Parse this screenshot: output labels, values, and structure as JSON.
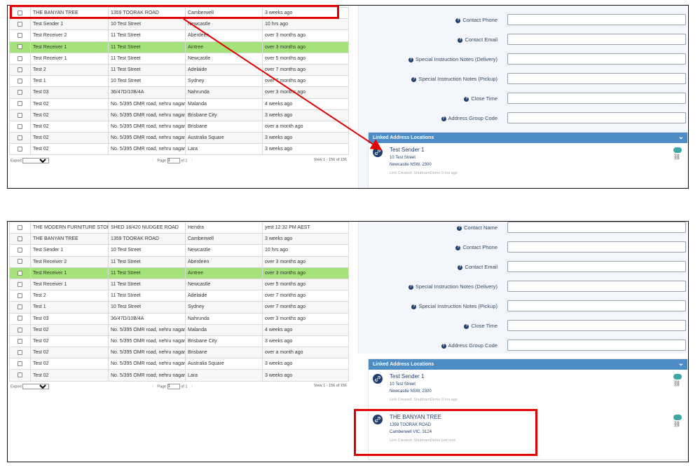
{
  "top": {
    "rows": [
      {
        "name": "THE BANYAN TREE",
        "address": "1359 TOORAK ROAD",
        "suburb": "Camberwell",
        "time": "3 weeks ago"
      },
      {
        "name": "Test Sender 1",
        "address": "10 Test Street",
        "suburb": "Newcastle",
        "time": "10 hrs ago"
      },
      {
        "name": "Test Receiver 2",
        "address": "11 Test Street",
        "suburb": "Aberdeen",
        "time": "over 3 months ago"
      },
      {
        "name": "Test Receiver 1",
        "address": "11 Test Street",
        "suburb": "Aintree",
        "time": "over 3 months ago",
        "selected": true
      },
      {
        "name": "Test Receiver 1",
        "address": "11 Test Street",
        "suburb": "Newcastle",
        "time": "over 5 months ago"
      },
      {
        "name": "Test 2",
        "address": "11 Test Street",
        "suburb": "Adelaide",
        "time": "over 7 months ago"
      },
      {
        "name": "Test 1",
        "address": "10 Test Street",
        "suburb": "Sydney",
        "time": "over 7 months ago"
      },
      {
        "name": "Test 03",
        "address": "36/47D/10B/4A",
        "suburb": "Nahrunda",
        "time": "over 3 months ago"
      },
      {
        "name": "Test 02",
        "address": "No. 5/395 OMR road, nehru nagar",
        "suburb": "Malanda",
        "time": "4 weeks ago"
      },
      {
        "name": "Test 02",
        "address": "No. 5/395 OMR road, nehru nagar",
        "suburb": "Brisbane City",
        "time": "3 weeks ago"
      },
      {
        "name": "Test 02",
        "address": "No. 5/395 OMR road, nehru nagar",
        "suburb": "Brisbane",
        "time": "over a month ago"
      },
      {
        "name": "Test 02",
        "address": "No. 5/395 OMR road, nehru nagar",
        "suburb": "Australia Square",
        "time": "3 weeks ago"
      },
      {
        "name": "Test 02",
        "address": "No. 5/395 OMR road, nehru nagar",
        "suburb": "Lara",
        "time": "3 weeks ago"
      }
    ],
    "form": [
      {
        "label": "Contact Phone"
      },
      {
        "label": "Contact Email"
      },
      {
        "label": "Special Instruction Notes (Delivery)"
      },
      {
        "label": "Special Instruction Notes (Pickup)"
      },
      {
        "label": "Close Time"
      },
      {
        "label": "Address Group Code"
      }
    ],
    "locations": [
      {
        "name": "Test Sender 1",
        "street": "10 Test Street",
        "city": "Newcastle NSW, 2300",
        "meta": "Link Created: ShubhamDemo 9 hrs ago"
      }
    ]
  },
  "bottom": {
    "rows": [
      {
        "name": "THE MODERN FURNITURE STORE",
        "address": "SHED 18/420 NUDGEE ROAD",
        "suburb": "Hendra",
        "time": "yest 12:32 PM AEST"
      },
      {
        "name": "THE BANYAN TREE",
        "address": "1359 TOORAK ROAD",
        "suburb": "Camberwell",
        "time": "3 weeks ago"
      },
      {
        "name": "Test Sender 1",
        "address": "10 Test Street",
        "suburb": "Newcastle",
        "time": "10 hrs ago"
      },
      {
        "name": "Test Receiver 2",
        "address": "11 Test Street",
        "suburb": "Aberdeen",
        "time": "over 3 months ago"
      },
      {
        "name": "Test Receiver 1",
        "address": "11 Test Street",
        "suburb": "Aintree",
        "time": "over 3 months ago",
        "selected": true
      },
      {
        "name": "Test Receiver 1",
        "address": "11 Test Street",
        "suburb": "Newcastle",
        "time": "over 5 months ago"
      },
      {
        "name": "Test 2",
        "address": "11 Test Street",
        "suburb": "Adelaide",
        "time": "over 7 months ago"
      },
      {
        "name": "Test 1",
        "address": "10 Test Street",
        "suburb": "Sydney",
        "time": "over 7 months ago"
      },
      {
        "name": "Test 03",
        "address": "36/47D/10B/4A",
        "suburb": "Nahrunda",
        "time": "over 3 months ago"
      },
      {
        "name": "Test 02",
        "address": "No. 5/395 OMR road, nehru nagar",
        "suburb": "Malanda",
        "time": "4 weeks ago"
      },
      {
        "name": "Test 02",
        "address": "No. 5/395 OMR road, nehru nagar",
        "suburb": "Brisbane City",
        "time": "3 weeks ago"
      },
      {
        "name": "Test 02",
        "address": "No. 5/395 OMR road, nehru nagar",
        "suburb": "Brisbane",
        "time": "over a month ago"
      },
      {
        "name": "Test 02",
        "address": "No. 5/395 OMR road, nehru nagar",
        "suburb": "Australia Square",
        "time": "3 weeks ago"
      },
      {
        "name": "Test 02",
        "address": "No. 5/395 OMR road, nehru nagar",
        "suburb": "Lara",
        "time": "3 weeks ago"
      }
    ],
    "form": [
      {
        "label": "Contact Name"
      },
      {
        "label": "Contact Phone"
      },
      {
        "label": "Contact Email"
      },
      {
        "label": "Special Instruction Notes (Delivery)"
      },
      {
        "label": "Special Instruction Notes (Pickup)"
      },
      {
        "label": "Close Time"
      },
      {
        "label": "Address Group Code"
      }
    ],
    "locations": [
      {
        "name": "Test Sender 1",
        "street": "10 Test Street",
        "city": "Newcastle NSW, 2300",
        "meta": "Link Created: ShubhamDemo 9 hrs ago"
      },
      {
        "name": "THE BANYAN TREE",
        "street": "1359 TOORAK ROAD",
        "city": "Camberwell VIC, 3124",
        "meta": "Link Created: ShubhamDemo just now"
      }
    ]
  },
  "pager": {
    "export_label": "Export",
    "page_label": "Page",
    "page_value": "1",
    "of_label": "of 1",
    "view_label": "View 1 - 156 of 156",
    "prev": "‹",
    "next": "›"
  },
  "linked_header": "Linked Address Locations",
  "help_glyph": "?",
  "colors": {
    "selected_row": "#a6e27a",
    "header_blue": "#4e8cc6",
    "annotation_red": "#e00000",
    "toggle_teal": "#3fa7a3",
    "badge_navy": "#1f3f6e"
  }
}
